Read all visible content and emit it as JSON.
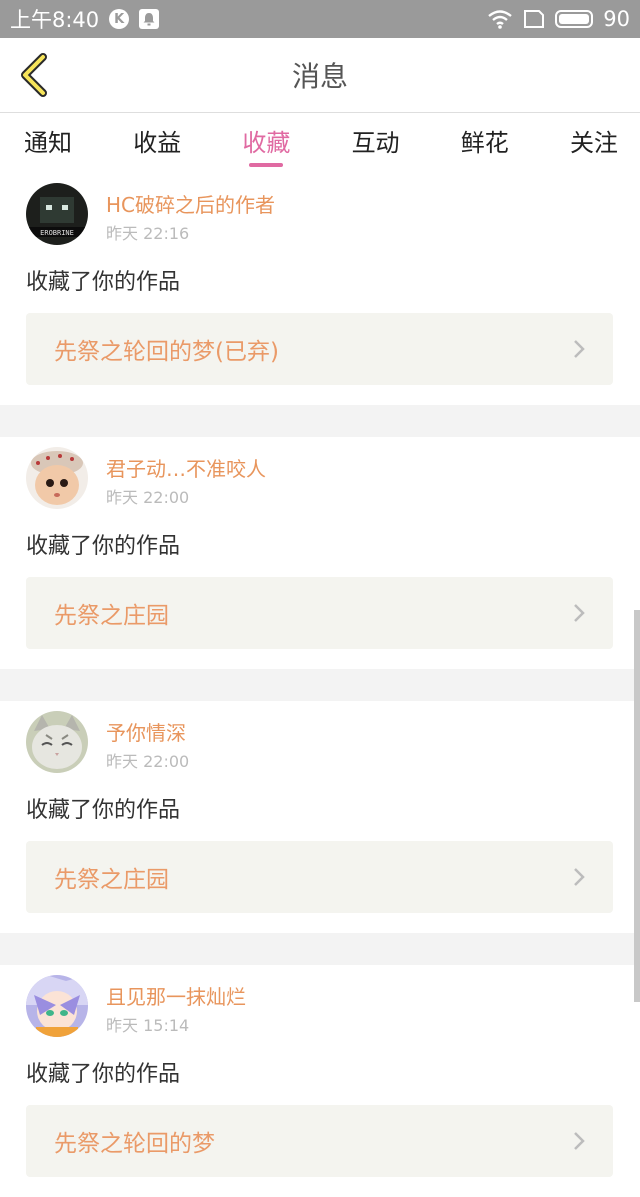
{
  "status_bar": {
    "time": "上午8:40",
    "k_badge": "K",
    "battery": "90"
  },
  "header": {
    "title": "消息"
  },
  "tabs": [
    {
      "label": "通知",
      "active": false
    },
    {
      "label": "收益",
      "active": false
    },
    {
      "label": "收藏",
      "active": true
    },
    {
      "label": "互动",
      "active": false
    },
    {
      "label": "鲜花",
      "active": false
    },
    {
      "label": "关注",
      "active": false
    }
  ],
  "messages": [
    {
      "user": "HC破碎之后的作者",
      "time": "昨天 22:16",
      "action": "收藏了你的作品",
      "work": "先祭之轮回的梦(已弃)",
      "avatar_text": "EROBRINE"
    },
    {
      "user": "君子动…不准咬人",
      "time": "昨天 22:00",
      "action": "收藏了你的作品",
      "work": "先祭之庄园"
    },
    {
      "user": "予你情深",
      "time": "昨天 22:00",
      "action": "收藏了你的作品",
      "work": "先祭之庄园"
    },
    {
      "user": "且见那一抹灿烂",
      "time": "昨天 15:14",
      "action": "收藏了你的作品",
      "work": "先祭之轮回的梦"
    }
  ],
  "colors": {
    "accent": "#e06aa2",
    "username": "#e8955c",
    "work_title": "#ea9a68",
    "status_bar": "#9a9a9a"
  }
}
